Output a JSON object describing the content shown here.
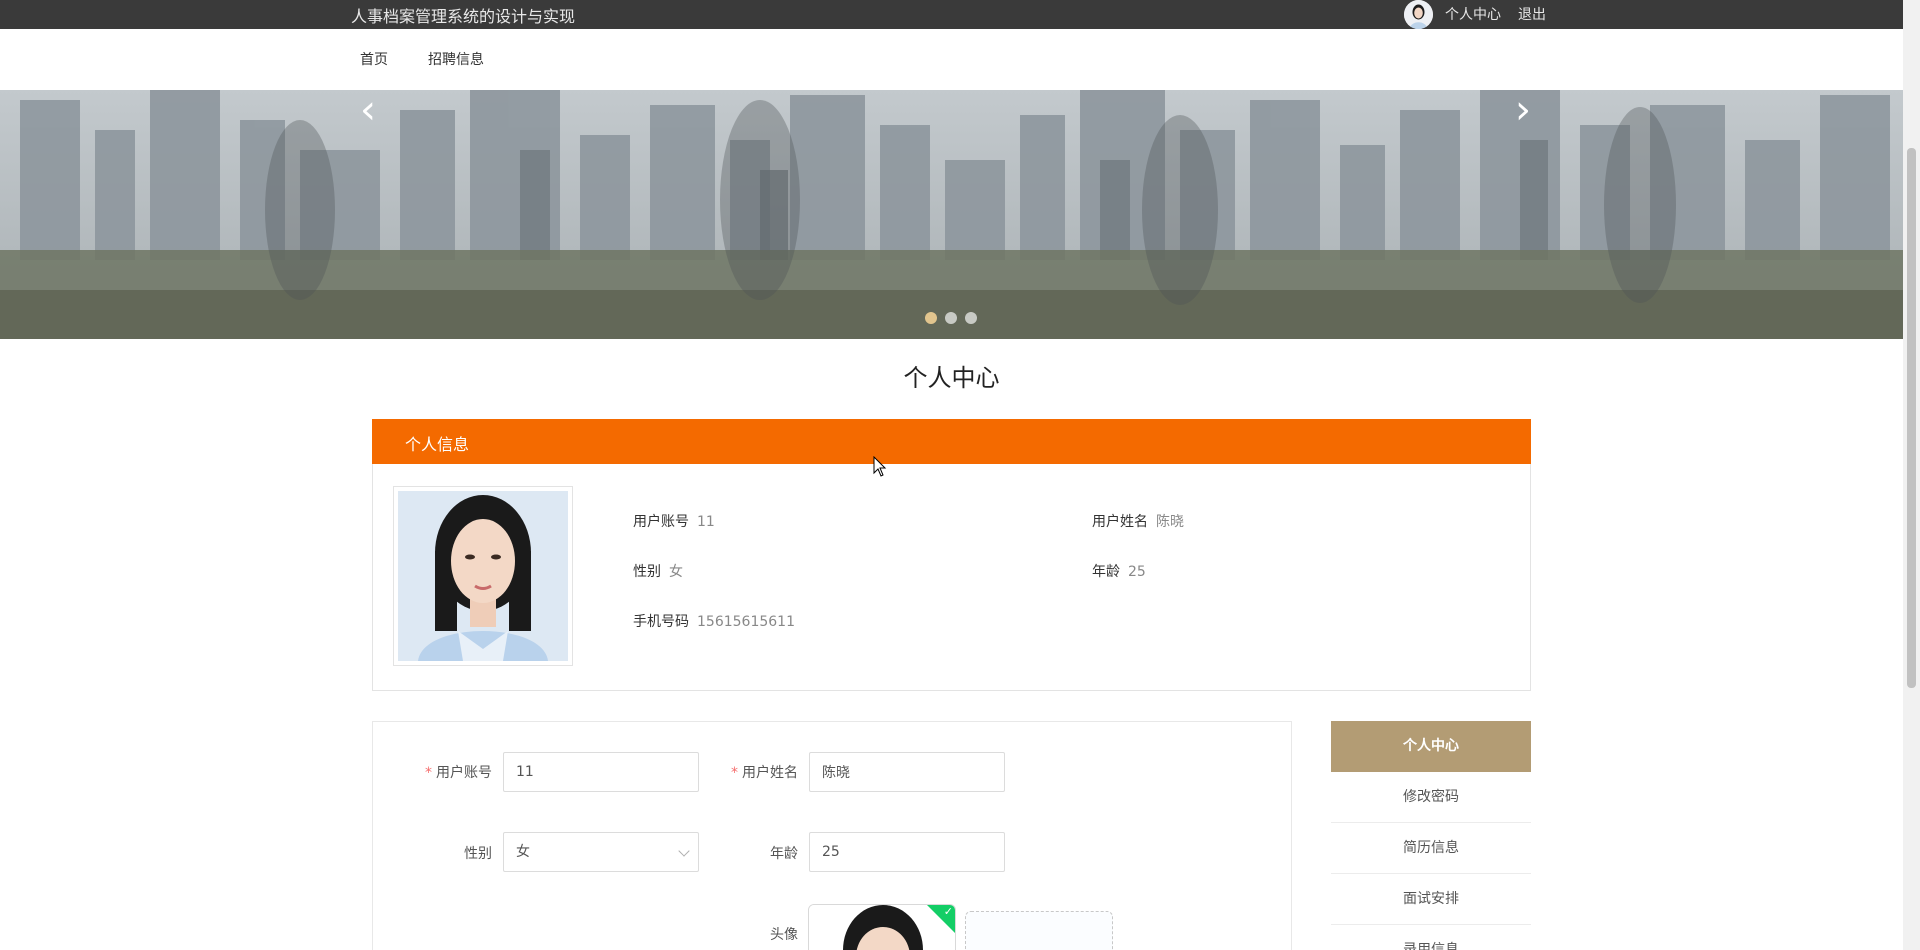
{
  "topbar": {
    "site_title": "人事档案管理系统的设计与实现",
    "user_center_label": "个人中心",
    "logout_label": "退出"
  },
  "nav": {
    "items": [
      {
        "label": "首页"
      },
      {
        "label": "招聘信息"
      }
    ]
  },
  "banner": {
    "prev_arrow": "‹",
    "next_arrow": "›",
    "dots": 3,
    "active_dot": 1
  },
  "page_title": "个人中心",
  "profile_card": {
    "header_title": "个人信息",
    "fields": {
      "account_label": "用户账号",
      "account_value": "11",
      "name_label": "用户姓名",
      "name_value": "陈晓",
      "gender_label": "性别",
      "gender_value": "女",
      "age_label": "年龄",
      "age_value": "25",
      "phone_label": "手机号码",
      "phone_value": "15615615611"
    }
  },
  "form": {
    "account_label": "用户账号",
    "account_value": "11",
    "name_label": "用户姓名",
    "name_value": "陈晓",
    "gender_label": "性别",
    "gender_value": "女",
    "age_label": "年龄",
    "age_value": "25",
    "avatar_label": "头像"
  },
  "side_menu": {
    "items": [
      {
        "label": "个人中心",
        "active": true
      },
      {
        "label": "修改密码",
        "active": false
      },
      {
        "label": "简历信息",
        "active": false
      },
      {
        "label": "面试安排",
        "active": false
      },
      {
        "label": "录用信息",
        "active": false
      }
    ]
  },
  "colors": {
    "topbar_bg": "#3a3a3a",
    "header_orange": "#f46a00",
    "menu_active": "#b39c74",
    "required_star": "#f56c6c",
    "upload_success": "#13ce66"
  }
}
